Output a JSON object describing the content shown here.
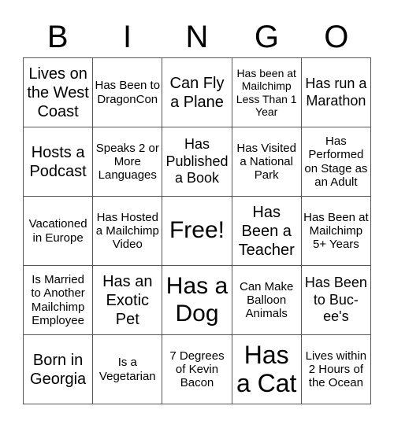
{
  "title_letters": [
    "B",
    "I",
    "N",
    "G",
    "O"
  ],
  "cells": [
    [
      "Lives on the West Coast",
      "Has Been to DragonCon",
      "Can Fly a Plane",
      "Has been at Mailchimp Less Than 1 Year",
      "Has run a Marathon"
    ],
    [
      "Hosts a Podcast",
      "Speaks 2 or More Languages",
      "Has Published a Book",
      "Has Visited a National Park",
      "Has Performed on Stage as an Adult"
    ],
    [
      "Vacationed in Europe",
      "Has Hosted a Mailchimp Video",
      "Free!",
      "Has Been a Teacher",
      "Has Been at Mailchimp 5+ Years"
    ],
    [
      "Is Married to Another Mailchimp Employee",
      "Has an Exotic Pet",
      "Has a Dog",
      "Can Make Balloon Animals",
      "Has Been to Buc-ee's"
    ],
    [
      "Born in Georgia",
      "Is a Vegetarian",
      "7 Degrees of Kevin Bacon",
      "Has a Cat",
      "Lives within 2 Hours of the Ocean"
    ]
  ]
}
